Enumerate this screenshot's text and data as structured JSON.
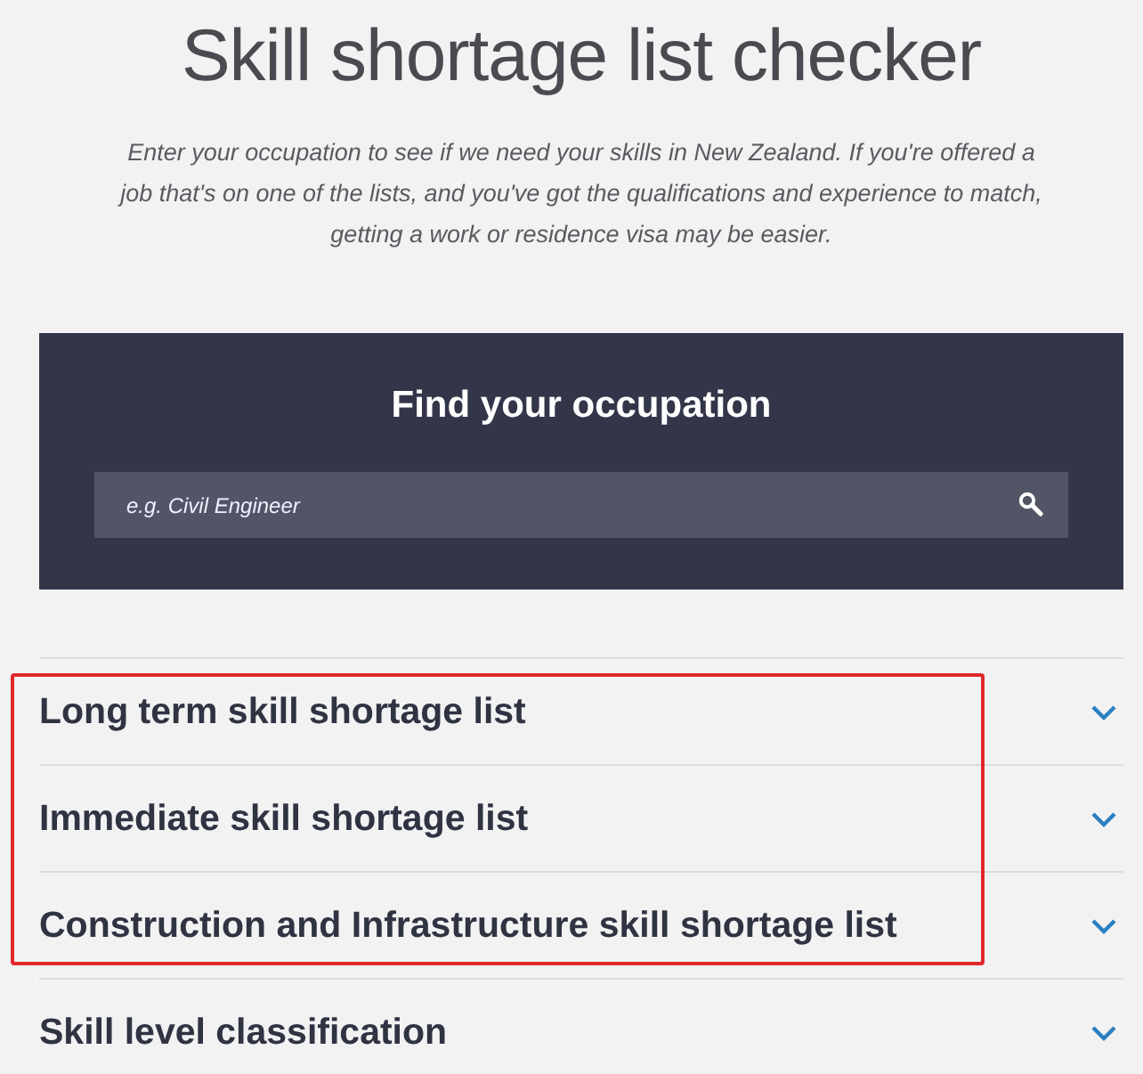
{
  "title": "Skill shortage list checker",
  "intro": "Enter your occupation to see if we need your skills in New Zealand. If you're offered a job that's on one of the lists, and you've got the qualifications and experience to match, getting a work or residence visa may be easier.",
  "search_panel": {
    "heading": "Find your occupation",
    "placeholder": "e.g. Civil Engineer"
  },
  "lists": [
    {
      "label": "Long term skill shortage list",
      "expanded": false,
      "highlighted": true
    },
    {
      "label": "Immediate skill shortage list",
      "expanded": false,
      "highlighted": true
    },
    {
      "label": "Construction and Infrastructure skill shortage list",
      "expanded": false,
      "highlighted": true
    },
    {
      "label": "Skill level classification",
      "expanded": false,
      "highlighted": false
    }
  ]
}
